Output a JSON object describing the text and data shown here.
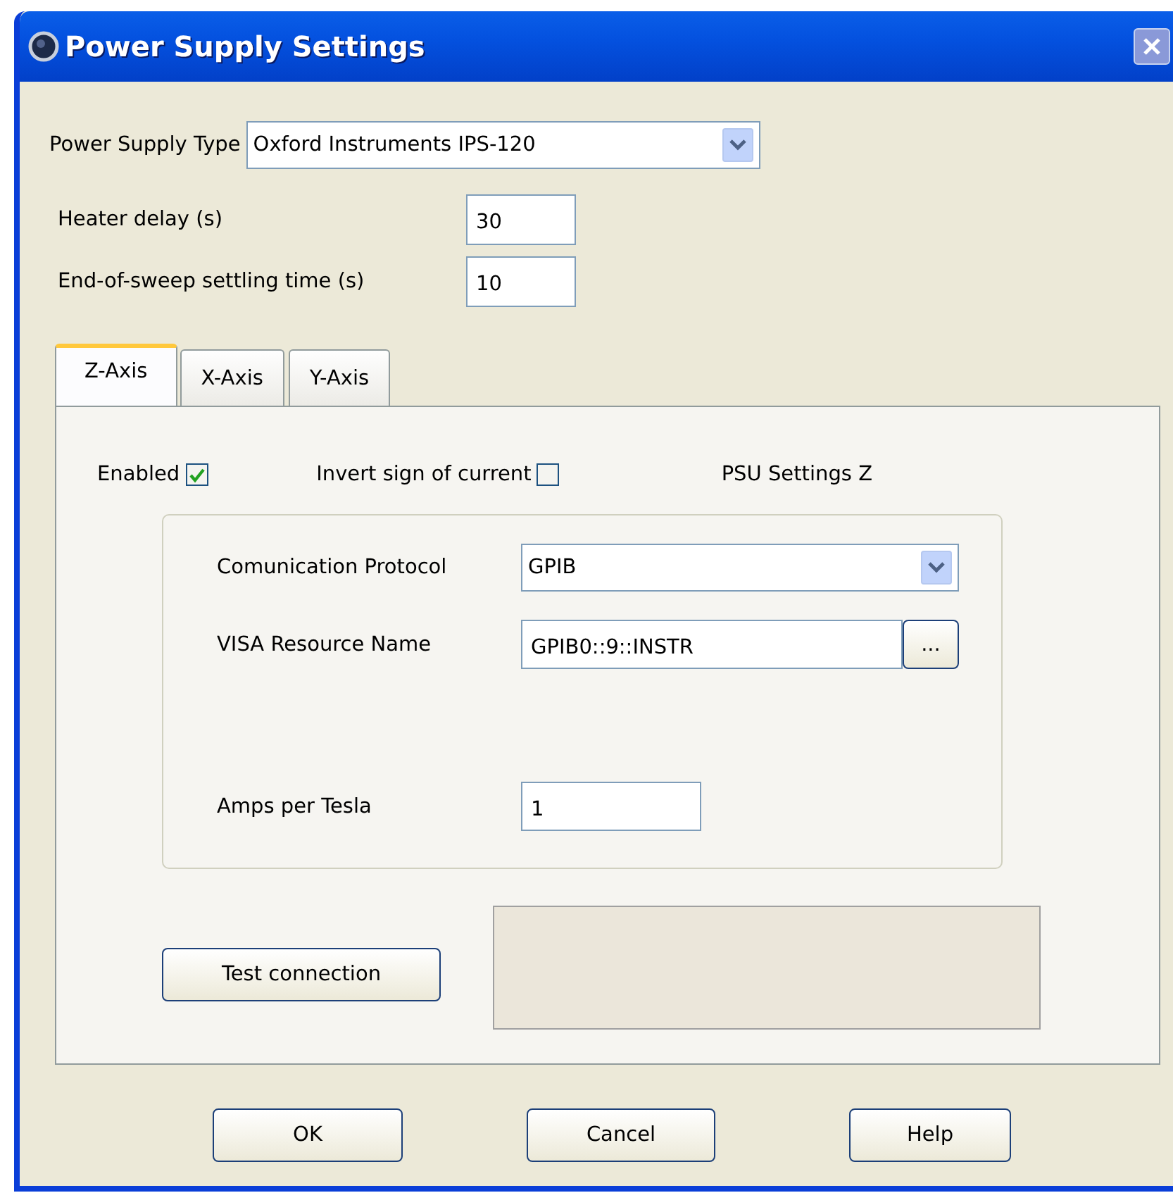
{
  "window": {
    "title": "Power Supply Settings"
  },
  "power_supply_type": {
    "label": "Power Supply Type",
    "value": "Oxford Instruments IPS-120"
  },
  "fields": [
    {
      "label": "Heater delay (s)",
      "value": "30"
    },
    {
      "label": "End-of-sweep settling time (s)",
      "value": "10"
    }
  ],
  "tabs": [
    {
      "label": "Z-Axis",
      "selected": true
    },
    {
      "label": "X-Axis",
      "selected": false
    },
    {
      "label": "Y-Axis",
      "selected": false
    }
  ],
  "options": [
    {
      "label": "Enabled",
      "checked": true
    },
    {
      "label": "Invert sign of current",
      "checked": false
    }
  ],
  "psu_label": "PSU Settings Z",
  "group": {
    "protocol": {
      "label": "Comunication Protocol",
      "value": "GPIB"
    },
    "resource": {
      "label": "VISA Resource Name",
      "value": "GPIB0::9::INSTR",
      "browse": "..."
    },
    "amps": {
      "label": "Amps per Tesla",
      "value": "1"
    }
  },
  "test_button": "Test connection",
  "buttons": [
    "OK",
    "Cancel",
    "Help"
  ]
}
